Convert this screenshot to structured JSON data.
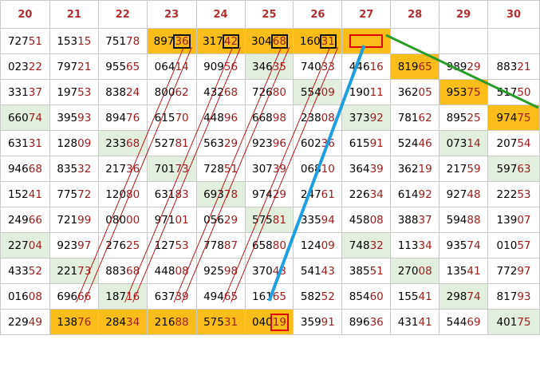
{
  "grid": {
    "headers": [
      "20",
      "21",
      "22",
      "23",
      "24",
      "25",
      "26",
      "27",
      "28",
      "29",
      "30"
    ],
    "rows": [
      [
        {
          "head": "727",
          "tail": "51",
          "bg": "w"
        },
        {
          "head": "153",
          "tail": "15",
          "bg": "w"
        },
        {
          "head": "751",
          "tail": "78",
          "bg": "w"
        },
        {
          "head": "897",
          "tail": "36",
          "bg": "o",
          "mark": "box"
        },
        {
          "head": "317",
          "tail": "42",
          "bg": "o",
          "mark": "box"
        },
        {
          "head": "304",
          "tail": "68",
          "bg": "o",
          "mark": "box"
        },
        {
          "head": "160",
          "tail": "31",
          "bg": "o",
          "mark": "box"
        },
        {
          "head": "",
          "tail": "",
          "bg": "o",
          "mark": "empty"
        },
        {
          "head": "",
          "tail": "",
          "bg": "w"
        },
        {
          "head": "",
          "tail": "",
          "bg": "w"
        },
        {
          "head": "",
          "tail": "",
          "bg": "w"
        }
      ],
      [
        {
          "head": "023",
          "tail": "22",
          "bg": "w"
        },
        {
          "head": "797",
          "tail": "21",
          "bg": "w"
        },
        {
          "head": "955",
          "tail": "65",
          "bg": "w"
        },
        {
          "head": "064",
          "tail": "14",
          "bg": "w"
        },
        {
          "head": "909",
          "tail": "56",
          "bg": "w"
        },
        {
          "head": "346",
          "tail": "35",
          "bg": "g"
        },
        {
          "head": "740",
          "tail": "33",
          "bg": "w"
        },
        {
          "head": "446",
          "tail": "16",
          "bg": "w"
        },
        {
          "head": "819",
          "tail": "65",
          "bg": "o"
        },
        {
          "head": "989",
          "tail": "29",
          "bg": "w"
        },
        {
          "head": "883",
          "tail": "21",
          "bg": "w"
        }
      ],
      [
        {
          "head": "331",
          "tail": "37",
          "bg": "w"
        },
        {
          "head": "197",
          "tail": "53",
          "bg": "w"
        },
        {
          "head": "838",
          "tail": "24",
          "bg": "w"
        },
        {
          "head": "800",
          "tail": "62",
          "bg": "w"
        },
        {
          "head": "432",
          "tail": "68",
          "bg": "w"
        },
        {
          "head": "726",
          "tail": "80",
          "bg": "w"
        },
        {
          "head": "554",
          "tail": "09",
          "bg": "g"
        },
        {
          "head": "190",
          "tail": "11",
          "bg": "w"
        },
        {
          "head": "362",
          "tail": "05",
          "bg": "w"
        },
        {
          "head": "953",
          "tail": "75",
          "bg": "o"
        },
        {
          "head": "517",
          "tail": "50",
          "bg": "w"
        }
      ],
      [
        {
          "head": "660",
          "tail": "74",
          "bg": "g"
        },
        {
          "head": "395",
          "tail": "93",
          "bg": "w"
        },
        {
          "head": "894",
          "tail": "76",
          "bg": "w"
        },
        {
          "head": "615",
          "tail": "70",
          "bg": "w"
        },
        {
          "head": "448",
          "tail": "96",
          "bg": "w"
        },
        {
          "head": "668",
          "tail": "98",
          "bg": "w"
        },
        {
          "head": "238",
          "tail": "08",
          "bg": "w"
        },
        {
          "head": "373",
          "tail": "92",
          "bg": "g"
        },
        {
          "head": "781",
          "tail": "62",
          "bg": "w"
        },
        {
          "head": "895",
          "tail": "25",
          "bg": "w"
        },
        {
          "head": "974",
          "tail": "75",
          "bg": "o"
        }
      ],
      [
        {
          "head": "631",
          "tail": "31",
          "bg": "w"
        },
        {
          "head": "128",
          "tail": "09",
          "bg": "w"
        },
        {
          "head": "233",
          "tail": "68",
          "bg": "g"
        },
        {
          "head": "527",
          "tail": "81",
          "bg": "w"
        },
        {
          "head": "563",
          "tail": "29",
          "bg": "w"
        },
        {
          "head": "923",
          "tail": "96",
          "bg": "w"
        },
        {
          "head": "602",
          "tail": "36",
          "bg": "w"
        },
        {
          "head": "615",
          "tail": "91",
          "bg": "w"
        },
        {
          "head": "524",
          "tail": "46",
          "bg": "w"
        },
        {
          "head": "073",
          "tail": "14",
          "bg": "g"
        },
        {
          "head": "207",
          "tail": "54",
          "bg": "w"
        }
      ],
      [
        {
          "head": "946",
          "tail": "68",
          "bg": "w"
        },
        {
          "head": "835",
          "tail": "32",
          "bg": "w"
        },
        {
          "head": "217",
          "tail": "36",
          "bg": "w"
        },
        {
          "head": "701",
          "tail": "73",
          "bg": "g"
        },
        {
          "head": "728",
          "tail": "51",
          "bg": "w"
        },
        {
          "head": "307",
          "tail": "39",
          "bg": "w"
        },
        {
          "head": "068",
          "tail": "10",
          "bg": "w"
        },
        {
          "head": "364",
          "tail": "39",
          "bg": "w"
        },
        {
          "head": "362",
          "tail": "19",
          "bg": "w"
        },
        {
          "head": "217",
          "tail": "59",
          "bg": "w"
        },
        {
          "head": "597",
          "tail": "63",
          "bg": "g"
        }
      ],
      [
        {
          "head": "152",
          "tail": "41",
          "bg": "w"
        },
        {
          "head": "775",
          "tail": "72",
          "bg": "w"
        },
        {
          "head": "120",
          "tail": "80",
          "bg": "w"
        },
        {
          "head": "631",
          "tail": "83",
          "bg": "w"
        },
        {
          "head": "693",
          "tail": "78",
          "bg": "g"
        },
        {
          "head": "974",
          "tail": "29",
          "bg": "w"
        },
        {
          "head": "247",
          "tail": "61",
          "bg": "w"
        },
        {
          "head": "226",
          "tail": "34",
          "bg": "w"
        },
        {
          "head": "614",
          "tail": "92",
          "bg": "w"
        },
        {
          "head": "927",
          "tail": "48",
          "bg": "w"
        },
        {
          "head": "222",
          "tail": "53",
          "bg": "w"
        }
      ],
      [
        {
          "head": "249",
          "tail": "66",
          "bg": "w"
        },
        {
          "head": "721",
          "tail": "99",
          "bg": "w"
        },
        {
          "head": "080",
          "tail": "00",
          "bg": "w"
        },
        {
          "head": "971",
          "tail": "01",
          "bg": "w"
        },
        {
          "head": "056",
          "tail": "29",
          "bg": "w"
        },
        {
          "head": "575",
          "tail": "81",
          "bg": "g"
        },
        {
          "head": "335",
          "tail": "94",
          "bg": "w"
        },
        {
          "head": "458",
          "tail": "08",
          "bg": "w"
        },
        {
          "head": "388",
          "tail": "37",
          "bg": "w"
        },
        {
          "head": "594",
          "tail": "88",
          "bg": "w"
        },
        {
          "head": "139",
          "tail": "07",
          "bg": "w"
        }
      ],
      [
        {
          "head": "227",
          "tail": "04",
          "bg": "g"
        },
        {
          "head": "923",
          "tail": "97",
          "bg": "w"
        },
        {
          "head": "276",
          "tail": "25",
          "bg": "w"
        },
        {
          "head": "127",
          "tail": "53",
          "bg": "w"
        },
        {
          "head": "778",
          "tail": "87",
          "bg": "w"
        },
        {
          "head": "658",
          "tail": "80",
          "bg": "w"
        },
        {
          "head": "124",
          "tail": "09",
          "bg": "w"
        },
        {
          "head": "748",
          "tail": "32",
          "bg": "g"
        },
        {
          "head": "113",
          "tail": "34",
          "bg": "w"
        },
        {
          "head": "935",
          "tail": "74",
          "bg": "w"
        },
        {
          "head": "010",
          "tail": "57",
          "bg": "w"
        }
      ],
      [
        {
          "head": "433",
          "tail": "52",
          "bg": "w"
        },
        {
          "head": "221",
          "tail": "73",
          "bg": "g"
        },
        {
          "head": "883",
          "tail": "68",
          "bg": "w"
        },
        {
          "head": "448",
          "tail": "08",
          "bg": "w"
        },
        {
          "head": "925",
          "tail": "98",
          "bg": "w"
        },
        {
          "head": "370",
          "tail": "43",
          "bg": "w"
        },
        {
          "head": "541",
          "tail": "43",
          "bg": "w"
        },
        {
          "head": "385",
          "tail": "51",
          "bg": "w"
        },
        {
          "head": "270",
          "tail": "08",
          "bg": "g"
        },
        {
          "head": "135",
          "tail": "41",
          "bg": "w"
        },
        {
          "head": "772",
          "tail": "97",
          "bg": "w"
        }
      ],
      [
        {
          "head": "016",
          "tail": "08",
          "bg": "w"
        },
        {
          "head": "696",
          "tail": "66",
          "bg": "w"
        },
        {
          "head": "187",
          "tail": "16",
          "bg": "g"
        },
        {
          "head": "637",
          "tail": "39",
          "bg": "w"
        },
        {
          "head": "494",
          "tail": "65",
          "bg": "w"
        },
        {
          "head": "161",
          "tail": "65",
          "bg": "w"
        },
        {
          "head": "582",
          "tail": "52",
          "bg": "w"
        },
        {
          "head": "854",
          "tail": "60",
          "bg": "w"
        },
        {
          "head": "155",
          "tail": "41",
          "bg": "w"
        },
        {
          "head": "298",
          "tail": "74",
          "bg": "g"
        },
        {
          "head": "817",
          "tail": "93",
          "bg": "w"
        }
      ],
      [
        {
          "head": "229",
          "tail": "49",
          "bg": "w"
        },
        {
          "head": "138",
          "tail": "76",
          "bg": "o"
        },
        {
          "head": "284",
          "tail": "34",
          "bg": "o"
        },
        {
          "head": "216",
          "tail": "88",
          "bg": "o"
        },
        {
          "head": "575",
          "tail": "31",
          "bg": "o"
        },
        {
          "head": "040",
          "tail": "19",
          "bg": "o",
          "mark": "redbox"
        },
        {
          "head": "359",
          "tail": "91",
          "bg": "w"
        },
        {
          "head": "896",
          "tail": "36",
          "bg": "w"
        },
        {
          "head": "431",
          "tail": "41",
          "bg": "w"
        },
        {
          "head": "544",
          "tail": "69",
          "bg": "w"
        },
        {
          "head": "401",
          "tail": "75",
          "bg": "g"
        }
      ]
    ]
  },
  "colors": {
    "highlight_orange": "#fbbd1a",
    "highlight_green": "#e3efde",
    "header_text": "#b03030",
    "tail_text": "#9a1c1c",
    "annotation_blue": "#1e9fe0",
    "annotation_green": "#2a9a2a",
    "annotation_red": "#c00000"
  }
}
